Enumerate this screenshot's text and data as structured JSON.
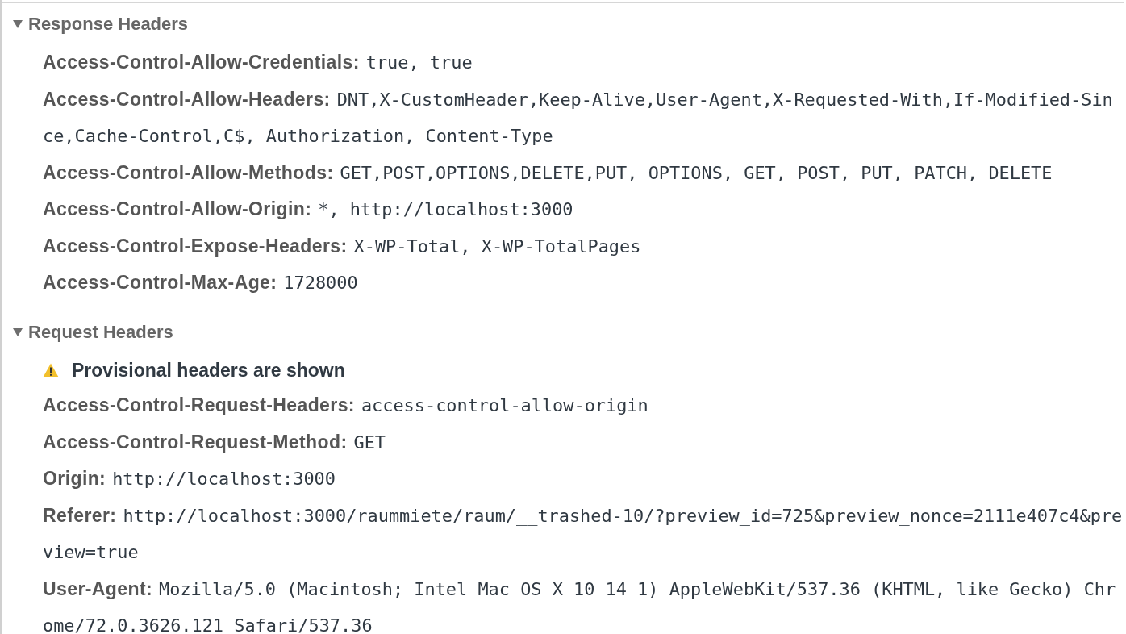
{
  "sections": [
    {
      "title": "Response Headers",
      "expanded": true,
      "headers": [
        {
          "name": "Access-Control-Allow-Credentials:",
          "value": "true, true"
        },
        {
          "name": "Access-Control-Allow-Headers:",
          "value": "DNT,X-CustomHeader,Keep-Alive,User-Agent,X-Requested-With,If-Modified-Since,Cache-Control,C$, Authorization, Content-Type"
        },
        {
          "name": "Access-Control-Allow-Methods:",
          "value": "GET,POST,OPTIONS,DELETE,PUT, OPTIONS, GET, POST, PUT, PATCH, DELETE"
        },
        {
          "name": "Access-Control-Allow-Origin:",
          "value": "*, http://localhost:3000"
        },
        {
          "name": "Access-Control-Expose-Headers:",
          "value": "X-WP-Total, X-WP-TotalPages"
        },
        {
          "name": "Access-Control-Max-Age:",
          "value": "1728000"
        }
      ]
    },
    {
      "title": "Request Headers",
      "expanded": true,
      "warning": "Provisional headers are shown",
      "headers": [
        {
          "name": "Access-Control-Request-Headers:",
          "value": "access-control-allow-origin"
        },
        {
          "name": "Access-Control-Request-Method:",
          "value": "GET"
        },
        {
          "name": "Origin:",
          "value": "http://localhost:3000"
        },
        {
          "name": "Referer:",
          "value": "http://localhost:3000/raummiete/raum/__trashed-10/?preview_id=725&preview_nonce=2111e407c4&preview=true"
        },
        {
          "name": "User-Agent:",
          "value": "Mozilla/5.0 (Macintosh; Intel Mac OS X 10_14_1) AppleWebKit/537.36 (KHTML, like Gecko) Chrome/72.0.3626.121 Safari/537.36"
        }
      ]
    }
  ]
}
